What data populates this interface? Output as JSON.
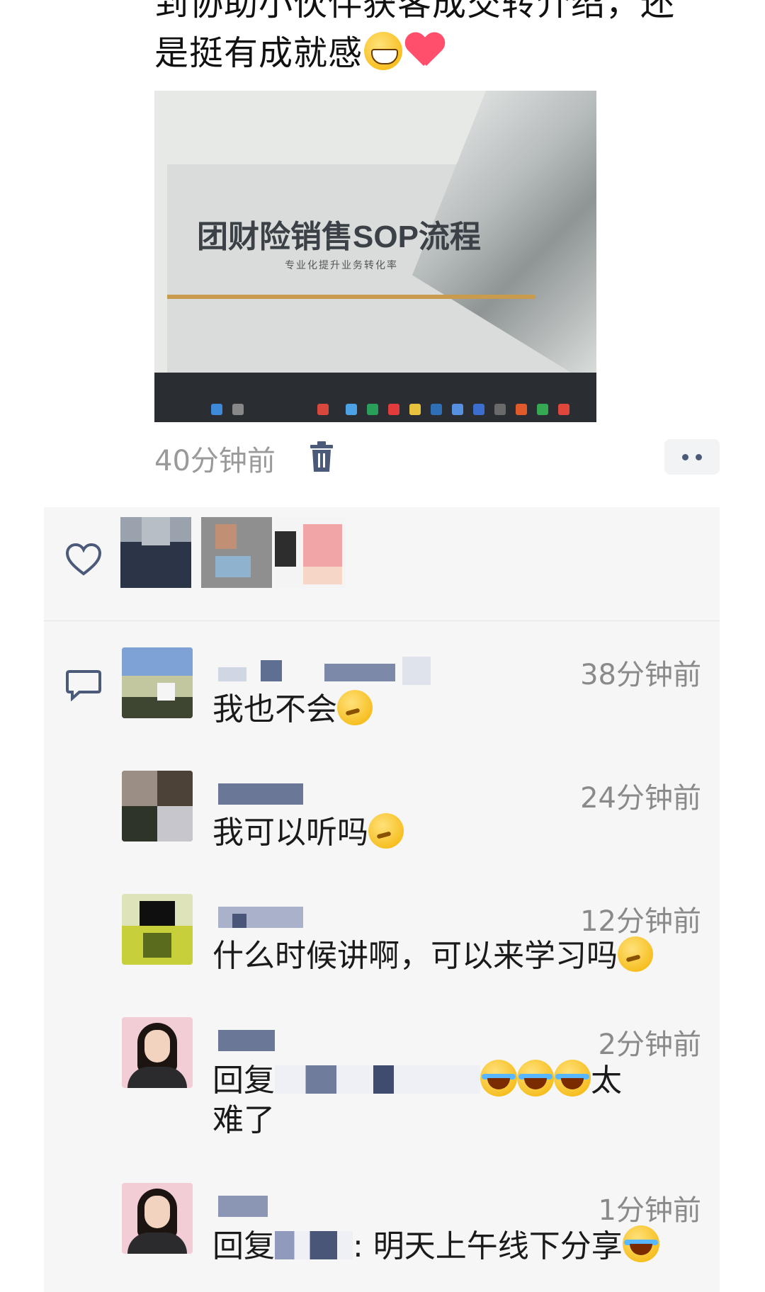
{
  "post": {
    "text_line1": "到协助小伙伴获客成交转介绍，还",
    "text_line2": "是挺有成就感",
    "emoji_grin": "grin-emoji",
    "emoji_heart": "heart-emoji",
    "image": {
      "slide_title": "团财险销售SOP流程",
      "slide_subtitle": "专业化提升业务转化率"
    },
    "time": "40分钟前"
  },
  "likes": {
    "icon": "heart-outline-icon",
    "avatars": [
      "avatar-blurred-1",
      "avatar-blurred-2",
      "avatar-blurred-3"
    ]
  },
  "comments": {
    "icon": "comment-icon",
    "items": [
      {
        "time": "38分钟前",
        "text": "我也不会",
        "emoji": "thinking-face-emoji"
      },
      {
        "time": "24分钟前",
        "text": "我可以听吗",
        "emoji": "thinking-face-emoji"
      },
      {
        "time": "12分钟前",
        "text": "什么时候讲啊，可以来学习吗",
        "emoji": "thinking-face-emoji"
      },
      {
        "time": "2分钟前",
        "reply_prefix": "回复",
        "text_after": "太",
        "text_line2": "难了",
        "emoji": "tears-of-joy-emoji"
      },
      {
        "time": "1分钟前",
        "reply_prefix": "回复",
        "text_after": ": 明天上午线下分享",
        "emoji": "tears-of-joy-emoji"
      }
    ]
  },
  "colors": {
    "background": "#ffffff",
    "panel": "#f6f6f6",
    "time_gray": "#8a8a8a",
    "link_blue": "#4c5a79"
  }
}
